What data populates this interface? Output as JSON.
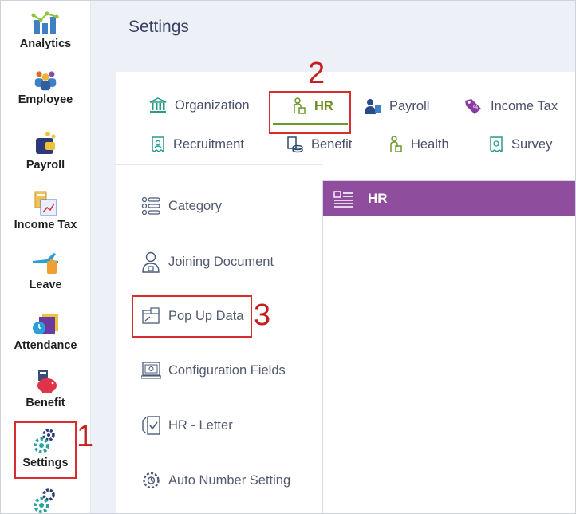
{
  "page": {
    "title": "Settings"
  },
  "sidenav": {
    "items": [
      {
        "label": "Analytics",
        "icon": "analytics-icon"
      },
      {
        "label": "Employee",
        "icon": "employee-icon"
      },
      {
        "label": "Payroll",
        "icon": "payroll-icon"
      },
      {
        "label": "Income Tax",
        "icon": "income-tax-icon"
      },
      {
        "label": "Leave",
        "icon": "leave-icon"
      },
      {
        "label": "Attendance",
        "icon": "attendance-icon"
      },
      {
        "label": "Benefit",
        "icon": "benefit-icon"
      },
      {
        "label": "Settings",
        "icon": "settings-icon"
      }
    ]
  },
  "tabs": {
    "row1": [
      {
        "label": "Organization",
        "icon": "organization-icon"
      },
      {
        "label": "HR",
        "icon": "hr-icon",
        "active": true
      },
      {
        "label": "Payroll",
        "icon": "payroll-user-icon"
      },
      {
        "label": "Income Tax",
        "icon": "income-tax-tag-icon"
      }
    ],
    "row2": [
      {
        "label": "Recruitment",
        "icon": "recruitment-icon"
      },
      {
        "label": "Benefit",
        "icon": "benefit-coins-icon"
      },
      {
        "label": "Health",
        "icon": "health-icon"
      },
      {
        "label": "Survey",
        "icon": "survey-icon"
      }
    ]
  },
  "menu": {
    "items": [
      {
        "label": "Category",
        "icon": "list-icon"
      },
      {
        "label": "Joining Document",
        "icon": "user-document-icon"
      },
      {
        "label": "Pop Up Data",
        "icon": "popup-window-icon"
      },
      {
        "label": "Configuration Fields",
        "icon": "config-fields-icon"
      },
      {
        "label": "HR - Letter",
        "icon": "letter-check-icon"
      },
      {
        "label": "Auto Number Setting",
        "icon": "auto-gear-icon"
      }
    ]
  },
  "panel": {
    "title": "HR",
    "icon": "header-list-icon"
  },
  "callouts": [
    "1",
    "2",
    "3"
  ],
  "colors": {
    "accent_purple": "#8e4e9d",
    "active_green": "#6b9a28",
    "callout_red": "#d62d2d"
  }
}
